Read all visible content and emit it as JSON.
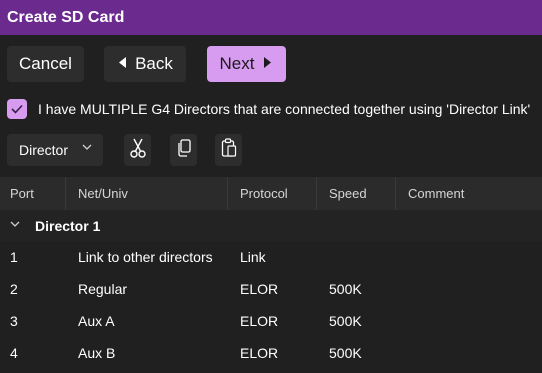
{
  "window": {
    "title": "Create SD Card"
  },
  "toolbar": {
    "cancel_label": "Cancel",
    "back_label": "Back",
    "next_label": "Next"
  },
  "multiple_directors": {
    "checked": true,
    "label": "I have MULTIPLE G4 Directors that are connected together using 'Director Link'"
  },
  "device_select": {
    "selected": "Director"
  },
  "grid": {
    "columns": [
      "Port",
      "Net/Univ",
      "Protocol",
      "Speed",
      "Comment"
    ],
    "groups": [
      {
        "title": "Director 1",
        "rows": [
          {
            "port": "1",
            "net": "Link to other directors",
            "protocol": "Link",
            "speed": "",
            "comment": ""
          },
          {
            "port": "2",
            "net": "Regular",
            "protocol": "ELOR",
            "speed": "500K",
            "comment": ""
          },
          {
            "port": "3",
            "net": "Aux A",
            "protocol": "ELOR",
            "speed": "500K",
            "comment": ""
          },
          {
            "port": "4",
            "net": "Aux B",
            "protocol": "ELOR",
            "speed": "500K",
            "comment": ""
          }
        ]
      }
    ]
  },
  "colors": {
    "titlebar": "#6a2a8e",
    "accent": "#d79bf0",
    "background": "#202020"
  }
}
